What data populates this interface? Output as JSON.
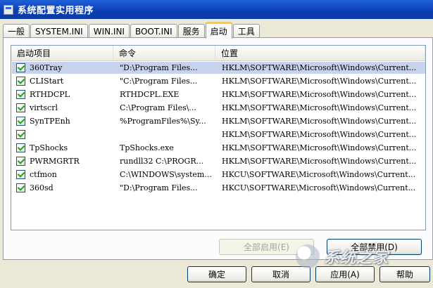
{
  "window": {
    "title": "系统配置实用程序"
  },
  "tabs": [
    {
      "label": "一般"
    },
    {
      "label": "SYSTEM.INI"
    },
    {
      "label": "WIN.INI"
    },
    {
      "label": "BOOT.INI"
    },
    {
      "label": "服务"
    },
    {
      "label": "启动",
      "active": true
    },
    {
      "label": "工具"
    }
  ],
  "startup_list": {
    "columns": [
      "启动项目",
      "命令",
      "位置"
    ],
    "rows": [
      {
        "checked": true,
        "item": "360Tray",
        "command": "\"D:\\Program Files...",
        "location": "HKLM\\SOFTWARE\\Microsoft\\Windows\\Current..."
      },
      {
        "checked": true,
        "item": "CLIStart",
        "command": "\"C:\\Program Files...",
        "location": "HKLM\\SOFTWARE\\Microsoft\\Windows\\Current..."
      },
      {
        "checked": true,
        "item": "RTHDCPL",
        "command": "RTHDCPL.EXE",
        "location": "HKLM\\SOFTWARE\\Microsoft\\Windows\\Current..."
      },
      {
        "checked": true,
        "item": "virtscrl",
        "command": "C:\\Program Files\\...",
        "location": "HKLM\\SOFTWARE\\Microsoft\\Windows\\Current..."
      },
      {
        "checked": true,
        "item": "SynTPEnh",
        "command": "%ProgramFiles%\\Sy...",
        "location": "HKLM\\SOFTWARE\\Microsoft\\Windows\\Current..."
      },
      {
        "checked": true,
        "item": "",
        "command": "",
        "location": "HKLM\\SOFTWARE\\Microsoft\\Windows\\Current..."
      },
      {
        "checked": true,
        "item": "TpShocks",
        "command": "TpShocks.exe",
        "location": "HKLM\\SOFTWARE\\Microsoft\\Windows\\Current..."
      },
      {
        "checked": true,
        "item": "PWRMGRTR",
        "command": "rundll32 C:\\PROGR...",
        "location": "HKLM\\SOFTWARE\\Microsoft\\Windows\\Current..."
      },
      {
        "checked": true,
        "item": "ctfmon",
        "command": "C:\\WINDOWS\\system...",
        "location": "HKCU\\SOFTWARE\\Microsoft\\Windows\\Current..."
      },
      {
        "checked": true,
        "item": "360sd",
        "command": "\"D:\\Program Files...",
        "location": "HKCU\\SOFTWARE\\Microsoft\\Windows\\Current..."
      }
    ]
  },
  "buttons": {
    "enable_all": "全部启用(E)",
    "disable_all": "全部禁用(D)",
    "ok": "确定",
    "cancel": "取消",
    "apply": "应用(A)",
    "help": "帮助"
  },
  "watermark": {
    "text": "系统之家"
  }
}
